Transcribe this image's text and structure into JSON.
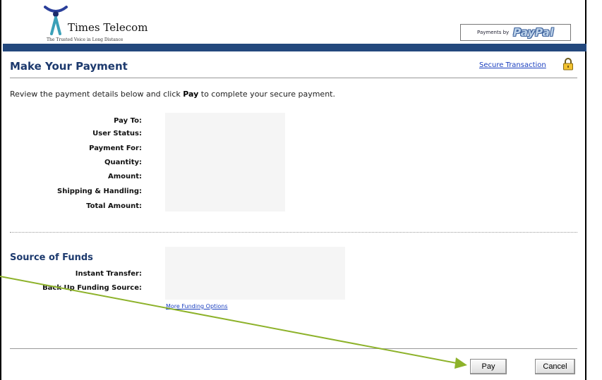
{
  "header": {
    "brand_name": "Times Telecom",
    "brand_tagline": "The Trusted Voice in Long Distance",
    "payments_by": "Payments by",
    "paypal": "PayPal"
  },
  "page": {
    "title": "Make Your Payment",
    "secure_link": "Secure Transaction",
    "intro_before": "Review the payment details below and click ",
    "intro_bold": "Pay",
    "intro_after": " to complete your secure payment."
  },
  "details": {
    "pay_to": "Pay To:",
    "user_status": "User Status:",
    "payment_for": "Payment For:",
    "quantity": "Quantity:",
    "amount": "Amount:",
    "shipping": "Shipping & Handling:",
    "total": "Total Amount:"
  },
  "funds": {
    "title": "Source of Funds",
    "instant_transfer": "Instant Transfer:",
    "backup": "Back Up Funding Source:",
    "more_link": "More Funding Options"
  },
  "buttons": {
    "pay": "Pay",
    "cancel": "Cancel"
  },
  "colors": {
    "accent_bar": "#23487d",
    "title": "#1d3a6e",
    "link": "#1a3fbf",
    "arrow": "#8db22a"
  }
}
